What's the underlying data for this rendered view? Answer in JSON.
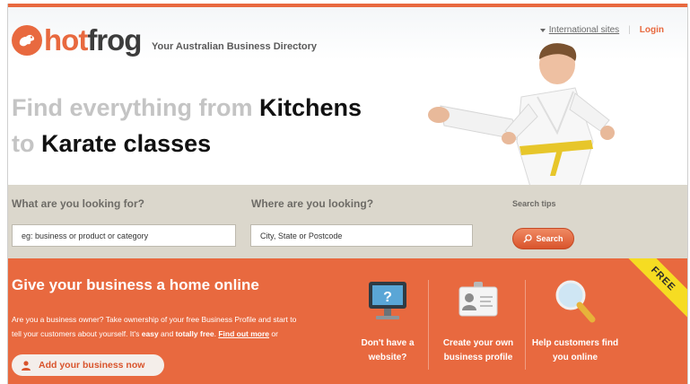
{
  "brand": {
    "hot": "hot",
    "frog": "frog",
    "tagline": "Your Australian Business Directory"
  },
  "header_links": {
    "international": "International sites",
    "separator": "|",
    "login": "Login"
  },
  "headline": {
    "line1_light": "Find everything from ",
    "line1_dark": "Kitchens",
    "line2_light": "to ",
    "line2_dark": "Karate classes"
  },
  "search": {
    "what_label": "What are you looking for?",
    "what_placeholder": "eg: business or product or category",
    "where_label": "Where are you looking?",
    "where_placeholder": "City, State or Postcode",
    "tips": "Search tips",
    "button": "Search"
  },
  "promo": {
    "title": "Give your business a home online",
    "para_1": "Are you a business owner? Take ownership of your free Business Profile and start to",
    "para_2a": "tell your customers about yourself. It's ",
    "para_easy": "easy",
    "para_and": " and ",
    "para_free": "totally free",
    "para_dot": ". ",
    "para_link": "Find out more",
    "para_or": " or",
    "add_button": "Add your business now",
    "badge": "FREE",
    "features": [
      {
        "line1": "Don't have a",
        "line2": "website?"
      },
      {
        "line1": "Create your own",
        "line2": "business profile"
      },
      {
        "line1": "Help customers find",
        "line2": "you online"
      }
    ]
  },
  "colors": {
    "accent": "#e8693f",
    "search_band": "#dbd7cc",
    "badge": "#f6dc22"
  }
}
